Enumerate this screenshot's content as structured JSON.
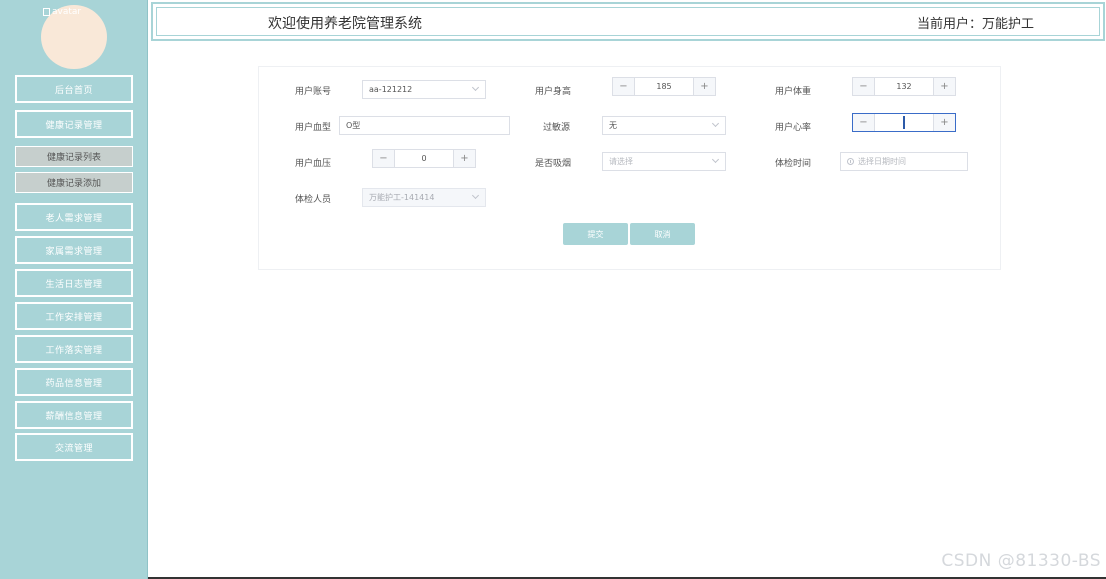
{
  "avatar": {
    "alt_text": "avatar"
  },
  "header": {
    "title": "欢迎使用养老院管理系统",
    "current_user": "当前用户：万能护工"
  },
  "sidebar": {
    "items": [
      {
        "label": "后台首页"
      },
      {
        "label": "健康记录管理"
      },
      {
        "label": "老人需求管理"
      },
      {
        "label": "家属需求管理"
      },
      {
        "label": "生活日志管理"
      },
      {
        "label": "工作安排管理"
      },
      {
        "label": "工作落实管理"
      },
      {
        "label": "药品信息管理"
      },
      {
        "label": "薪酬信息管理"
      },
      {
        "label": "交流管理"
      }
    ],
    "subitems": [
      {
        "label": "健康记录列表"
      },
      {
        "label": "健康记录添加"
      }
    ]
  },
  "form": {
    "account": {
      "label": "用户账号",
      "value": "aa-121212"
    },
    "height": {
      "label": "用户身高",
      "value": "185"
    },
    "weight": {
      "label": "用户体重",
      "value": "132"
    },
    "blood_type": {
      "label": "用户血型",
      "value": "O型"
    },
    "allergen": {
      "label": "过敏源",
      "value": "无"
    },
    "heart_rate": {
      "label": "用户心率",
      "value": ""
    },
    "blood_pressure": {
      "label": "用户血压",
      "value": "0"
    },
    "smoking": {
      "label": "是否吸烟",
      "placeholder": "请选择"
    },
    "exam_time": {
      "label": "体检时间",
      "placeholder": "选择日期时间"
    },
    "examiner": {
      "label": "体检人员",
      "value": "万能护工-141414"
    },
    "submit_label": "提交",
    "cancel_label": "取消"
  },
  "watermark": "CSDN @81330-BS"
}
